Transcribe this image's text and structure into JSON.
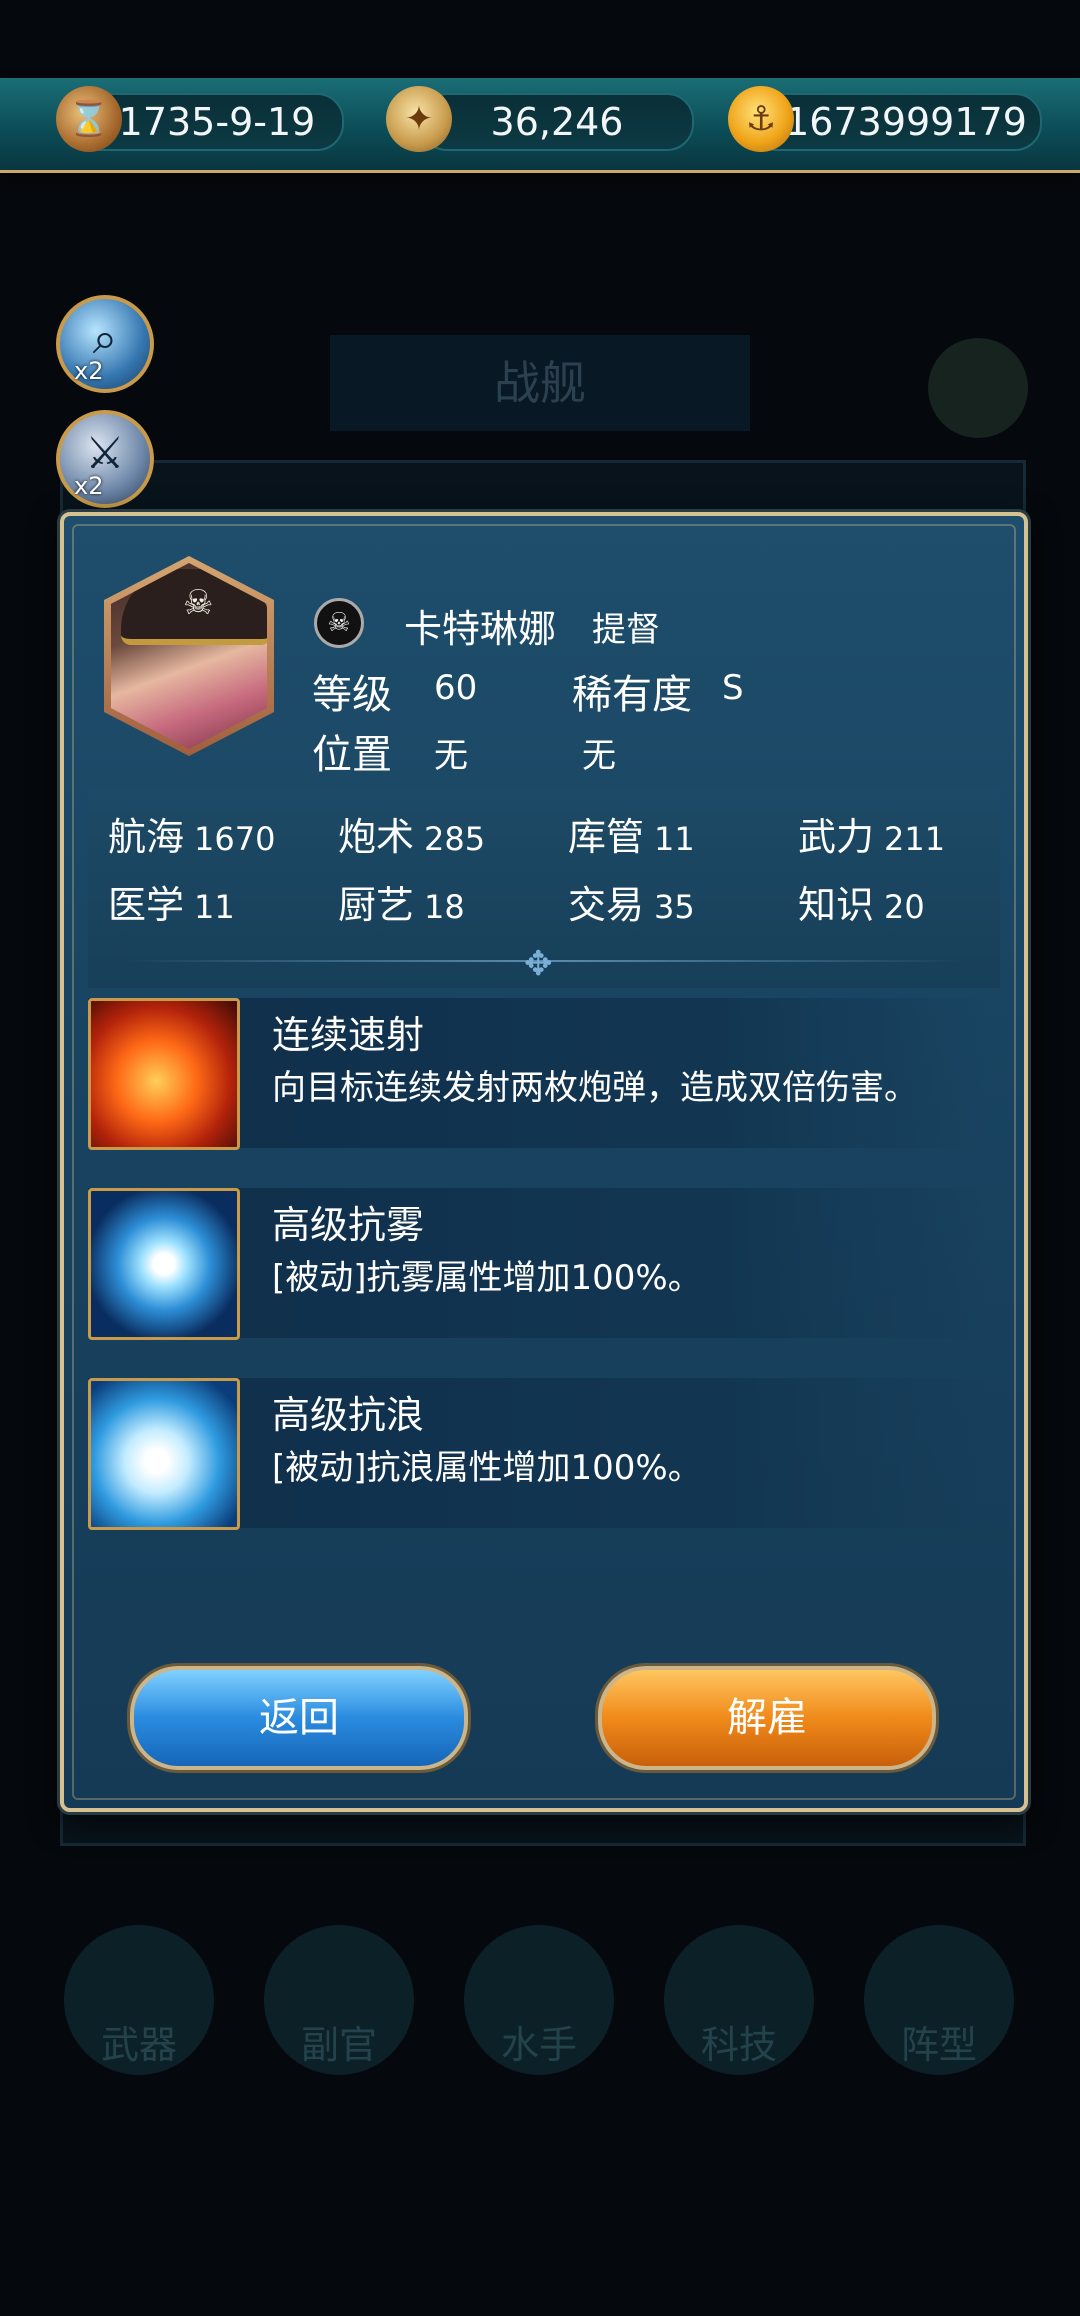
{
  "topbar": {
    "date": "1735-9-19",
    "compass_value": "36,246",
    "gold": "1673999179"
  },
  "side": {
    "search_badge": "x2",
    "battle_badge": "x2"
  },
  "background": {
    "title": "战舰",
    "nav": [
      "武器",
      "副官",
      "水手",
      "科技",
      "阵型"
    ]
  },
  "officer": {
    "name": "卡特琳娜",
    "rank": "提督",
    "level_label": "等级",
    "level": "60",
    "rarity_label": "稀有度",
    "rarity": "S",
    "position_label": "位置",
    "position_value1": "无",
    "position_value2": "无"
  },
  "stats": [
    {
      "label": "航海",
      "value": "1670"
    },
    {
      "label": "炮术",
      "value": "285"
    },
    {
      "label": "库管",
      "value": "11"
    },
    {
      "label": "武力",
      "value": "211"
    },
    {
      "label": "医学",
      "value": "11"
    },
    {
      "label": "厨艺",
      "value": "18"
    },
    {
      "label": "交易",
      "value": "35"
    },
    {
      "label": "知识",
      "value": "20"
    }
  ],
  "skills": [
    {
      "title": "连续速射",
      "desc": "向目标连续发射两枚炮弹，造成双倍伤害。",
      "icon": "fire-cannon-icon"
    },
    {
      "title": "高级抗雾",
      "desc": "[被动]抗雾属性增加100%。",
      "icon": "fog-resist-icon"
    },
    {
      "title": "高级抗浪",
      "desc": "[被动]抗浪属性增加100%。",
      "icon": "wave-resist-icon"
    }
  ],
  "buttons": {
    "back": "返回",
    "dismiss": "解雇"
  }
}
